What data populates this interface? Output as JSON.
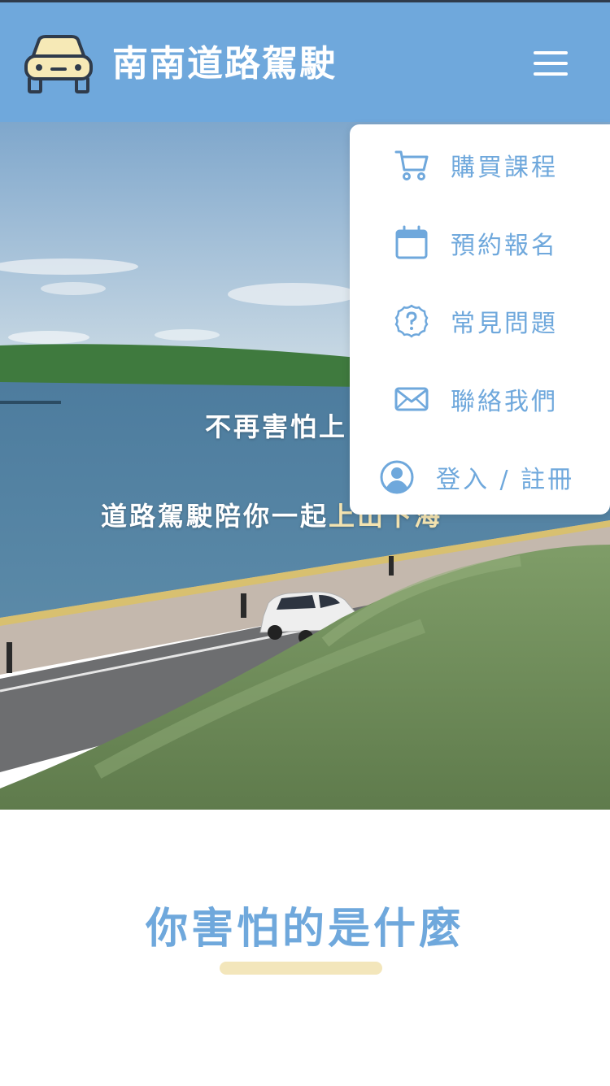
{
  "header": {
    "brand": "南南道路駕駛",
    "logo_icon": "car-front-icon",
    "menu_icon": "hamburger-menu-icon",
    "background_color": "#6fa8dc"
  },
  "hero": {
    "line1": "不再害怕上",
    "line2_prefix": "道路駕駛陪你一起",
    "line2_highlight": "上山下海",
    "highlight_color": "#f3e3b0"
  },
  "menu": {
    "items": [
      {
        "label": "購買課程",
        "icon": "shopping-cart-icon"
      },
      {
        "label": "預約報名",
        "icon": "calendar-icon"
      },
      {
        "label": "常見問題",
        "icon": "question-icon"
      },
      {
        "label": "聯絡我們",
        "icon": "mail-icon"
      },
      {
        "label": "登入 / 註冊",
        "icon": "user-circle-icon"
      }
    ],
    "accent_color": "#6fa8dc"
  },
  "section": {
    "title": "你害怕的是什麼",
    "underline_color": "#f3e6bb"
  }
}
